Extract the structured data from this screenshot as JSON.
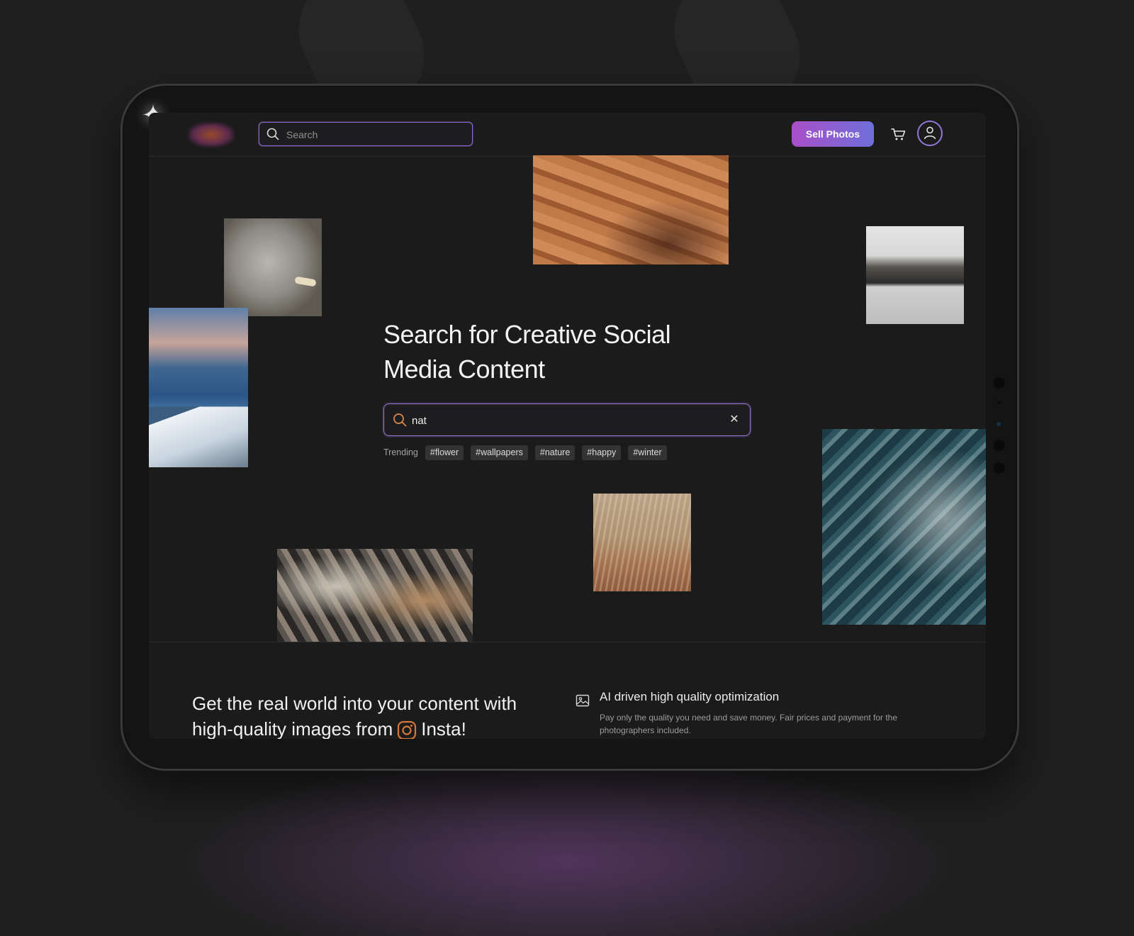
{
  "header": {
    "search_placeholder": "Search",
    "sell_button": "Sell Photos"
  },
  "hero": {
    "title": "Search for Creative Social Media Content",
    "search_value": "nat",
    "trending_label": "Trending",
    "tags": [
      "#flower",
      "#wallpapers",
      "#nature",
      "#happy",
      "#winter"
    ]
  },
  "features": {
    "headline_part1": "Get the real world into your content with high-quality images from",
    "headline_part2": "Insta!",
    "feature_title": "AI driven high quality optimization",
    "feature_desc": "Pay only the quality you need and save money. Fair prices and payment for the photographers included."
  },
  "colors": {
    "background": "#1f1f1f",
    "accent_gradient_start": "#a94fc8",
    "accent_gradient_end": "#6f6fd8",
    "instagram_icon": "#d4773a"
  },
  "icons": [
    "search-icon",
    "cart-icon",
    "user-icon",
    "close-icon",
    "image-icon",
    "instagram-icon",
    "sparkle-icon"
  ]
}
